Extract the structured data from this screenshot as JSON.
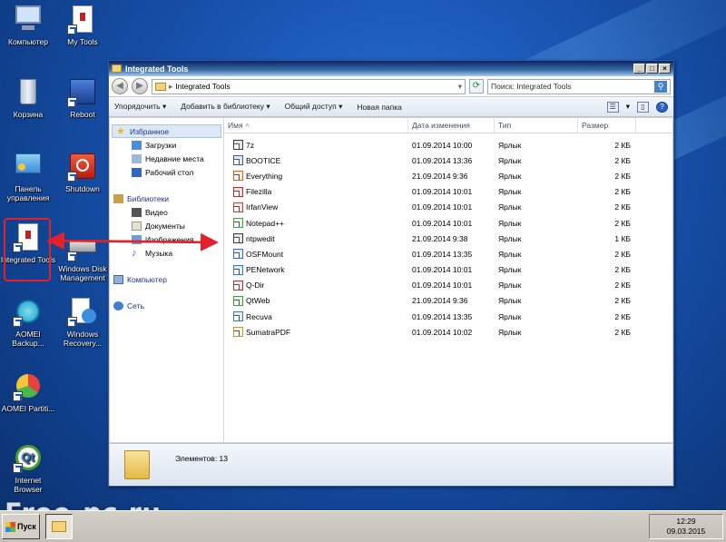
{
  "desktop": {
    "icons": [
      {
        "label": "Компьютер",
        "icon": "computer-icon"
      },
      {
        "label": "My Tools",
        "icon": "folder-icon"
      },
      {
        "label": "Корзина",
        "icon": "recycle-bin-icon"
      },
      {
        "label": "Reboot",
        "icon": "reboot-icon"
      },
      {
        "label": "Панель управления",
        "icon": "control-panel-icon"
      },
      {
        "label": "Shutdown",
        "icon": "shutdown-icon"
      },
      {
        "label": "Integrated Tools",
        "icon": "folder-icon"
      },
      {
        "label": "Windows Disk Management",
        "icon": "disk-management-icon"
      },
      {
        "label": "AOMEI Backup...",
        "icon": "aomei-backupper-icon"
      },
      {
        "label": "Windows Recovery...",
        "icon": "windows-recovery-icon"
      },
      {
        "label": "AOMEI Partiti...",
        "icon": "aomei-partition-icon"
      },
      {
        "label": "Internet Browser",
        "icon": "qtweb-icon"
      }
    ]
  },
  "window": {
    "title": "Integrated Tools",
    "address": "Integrated Tools",
    "search_placeholder": "Поиск: Integrated Tools",
    "toolbar": {
      "organize": "Упорядочить ▾",
      "add_to_library": "Добавить в библиотеку ▾",
      "share": "Общий доступ ▾",
      "new_folder": "Новая папка"
    },
    "nav": {
      "favorites": "Избранное",
      "downloads": "Загрузки",
      "recent": "Недавние места",
      "desktop": "Рабочий стол",
      "libraries": "Библиотеки",
      "video": "Видео",
      "documents": "Документы",
      "images": "Изображения",
      "music": "Музыка",
      "computer": "Компьютер",
      "network": "Сеть"
    },
    "columns": {
      "name": "Имя",
      "date": "Дата изменения",
      "type": "Тип",
      "size": "Размер"
    },
    "files": [
      {
        "name": "7z",
        "date": "01.09.2014 10:00",
        "type": "Ярлык",
        "size": "2 КБ"
      },
      {
        "name": "BOOTICE",
        "date": "01.09.2014 13:36",
        "type": "Ярлык",
        "size": "2 КБ"
      },
      {
        "name": "Everything",
        "date": "21.09.2014 9:36",
        "type": "Ярлык",
        "size": "2 КБ"
      },
      {
        "name": "Filezilla",
        "date": "01.09.2014 10:01",
        "type": "Ярлык",
        "size": "2 КБ"
      },
      {
        "name": "IrfanView",
        "date": "01.09.2014 10:01",
        "type": "Ярлык",
        "size": "2 КБ"
      },
      {
        "name": "Notepad++",
        "date": "01.09.2014 10:01",
        "type": "Ярлык",
        "size": "2 КБ"
      },
      {
        "name": "ntpwedit",
        "date": "21.09.2014 9:38",
        "type": "Ярлык",
        "size": "1 КБ"
      },
      {
        "name": "OSFMount",
        "date": "01.09.2014 13:35",
        "type": "Ярлык",
        "size": "2 КБ"
      },
      {
        "name": "PENetwork",
        "date": "01.09.2014 10:01",
        "type": "Ярлык",
        "size": "2 КБ"
      },
      {
        "name": "Q-Dir",
        "date": "01.09.2014 10:01",
        "type": "Ярлык",
        "size": "2 КБ"
      },
      {
        "name": "QtWeb",
        "date": "21.09.2014 9:36",
        "type": "Ярлык",
        "size": "2 КБ"
      },
      {
        "name": "Recuva",
        "date": "01.09.2014 13:35",
        "type": "Ярлык",
        "size": "2 КБ"
      },
      {
        "name": "SumatraPDF",
        "date": "01.09.2014 10:02",
        "type": "Ярлык",
        "size": "2 КБ"
      }
    ],
    "status": "Элементов: 13"
  },
  "taskbar": {
    "start": "Пуск",
    "time": "12:29",
    "date": "09.03.2015"
  },
  "watermark": "Free-pc.ru",
  "colors": {
    "highlight_red": "#e4202a",
    "desktop_blue": "#1a56b4"
  }
}
